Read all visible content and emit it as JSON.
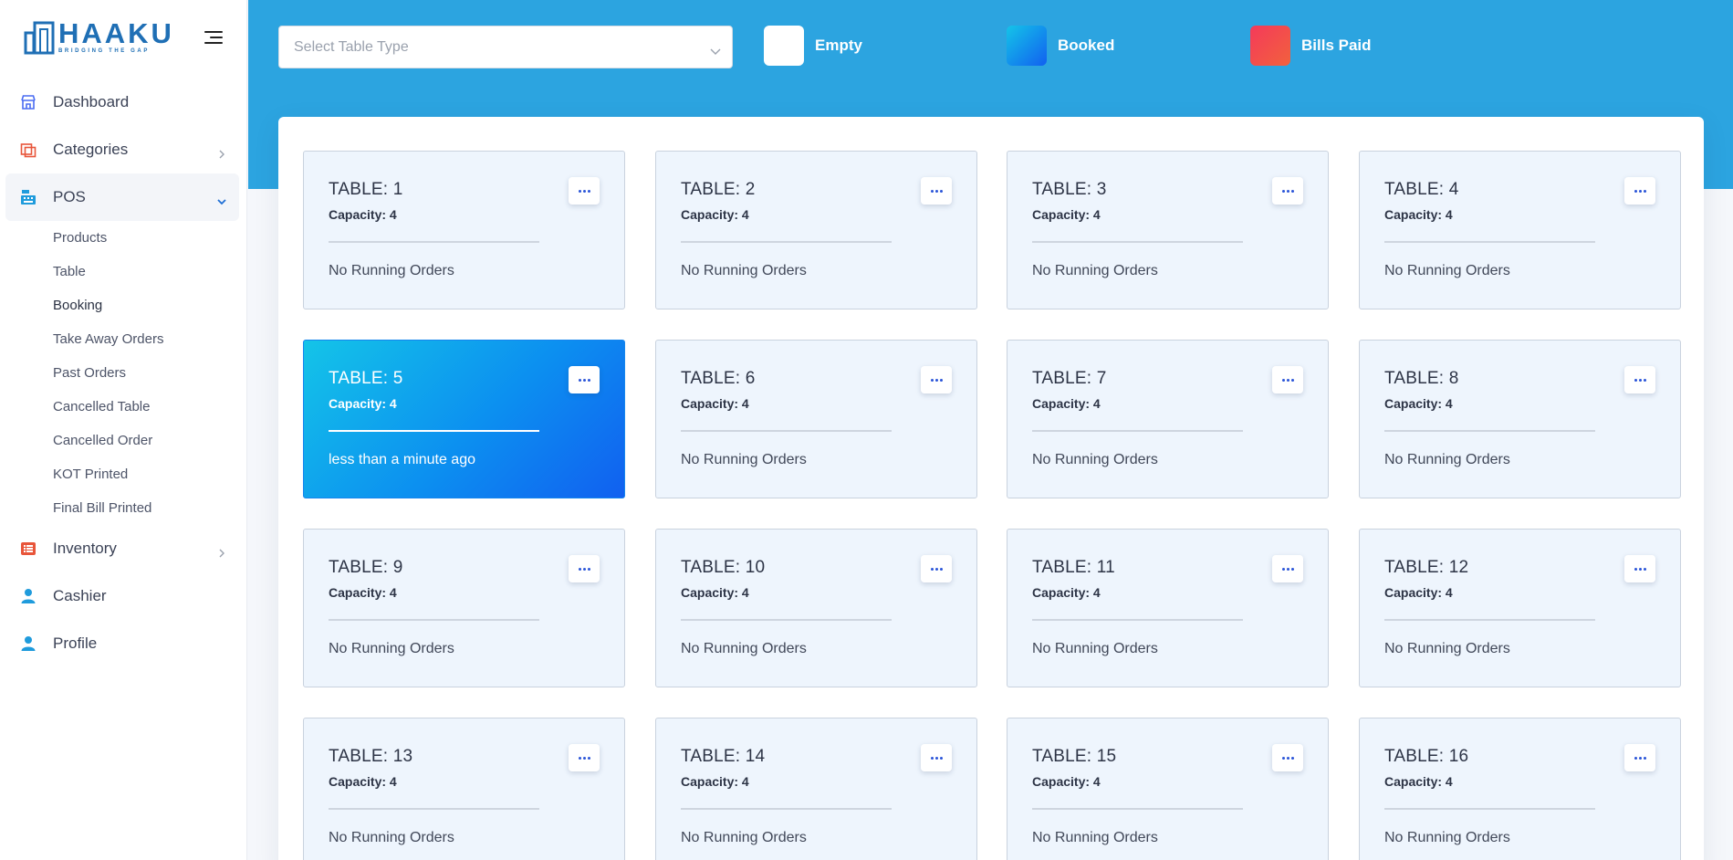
{
  "brand": {
    "title": "HAAKU",
    "tagline": "BRIDGING THE GAP"
  },
  "sidebar": {
    "items": [
      {
        "label": "Dashboard"
      },
      {
        "label": "Categories"
      },
      {
        "label": "POS"
      },
      {
        "label": "Inventory"
      },
      {
        "label": "Cashier"
      },
      {
        "label": "Profile"
      }
    ],
    "pos_sub": [
      {
        "label": "Products"
      },
      {
        "label": "Table"
      },
      {
        "label": "Booking"
      },
      {
        "label": "Take Away Orders"
      },
      {
        "label": "Past Orders"
      },
      {
        "label": "Cancelled Table"
      },
      {
        "label": "Cancelled Order"
      },
      {
        "label": "KOT Printed"
      },
      {
        "label": "Final Bill Printed"
      }
    ]
  },
  "filter": {
    "placeholder": "Select Table Type"
  },
  "legend": [
    {
      "label": "Empty",
      "color": "#ffffff"
    },
    {
      "label": "Booked",
      "color": "#1a7ff0"
    },
    {
      "label": "Bills Paid",
      "color": "#f2454b"
    }
  ],
  "tables": [
    {
      "title": "TABLE: 1",
      "capacity": "Capacity: 4",
      "status": "No Running Orders",
      "state": "empty"
    },
    {
      "title": "TABLE: 2",
      "capacity": "Capacity: 4",
      "status": "No Running Orders",
      "state": "empty"
    },
    {
      "title": "TABLE: 3",
      "capacity": "Capacity: 4",
      "status": "No Running Orders",
      "state": "empty"
    },
    {
      "title": "TABLE: 4",
      "capacity": "Capacity: 4",
      "status": "No Running Orders",
      "state": "empty"
    },
    {
      "title": "TABLE: 5",
      "capacity": "Capacity: 4",
      "status": "less than a minute ago",
      "state": "booked"
    },
    {
      "title": "TABLE: 6",
      "capacity": "Capacity: 4",
      "status": "No Running Orders",
      "state": "empty"
    },
    {
      "title": "TABLE: 7",
      "capacity": "Capacity: 4",
      "status": "No Running Orders",
      "state": "empty"
    },
    {
      "title": "TABLE: 8",
      "capacity": "Capacity: 4",
      "status": "No Running Orders",
      "state": "empty"
    },
    {
      "title": "TABLE: 9",
      "capacity": "Capacity: 4",
      "status": "No Running Orders",
      "state": "empty"
    },
    {
      "title": "TABLE: 10",
      "capacity": "Capacity: 4",
      "status": "No Running Orders",
      "state": "empty"
    },
    {
      "title": "TABLE: 11",
      "capacity": "Capacity: 4",
      "status": "No Running Orders",
      "state": "empty"
    },
    {
      "title": "TABLE: 12",
      "capacity": "Capacity: 4",
      "status": "No Running Orders",
      "state": "empty"
    },
    {
      "title": "TABLE: 13",
      "capacity": "Capacity: 4",
      "status": "No Running Orders",
      "state": "empty"
    },
    {
      "title": "TABLE: 14",
      "capacity": "Capacity: 4",
      "status": "No Running Orders",
      "state": "empty"
    },
    {
      "title": "TABLE: 15",
      "capacity": "Capacity: 4",
      "status": "No Running Orders",
      "state": "empty"
    },
    {
      "title": "TABLE: 16",
      "capacity": "Capacity: 4",
      "status": "No Running Orders",
      "state": "empty"
    }
  ]
}
